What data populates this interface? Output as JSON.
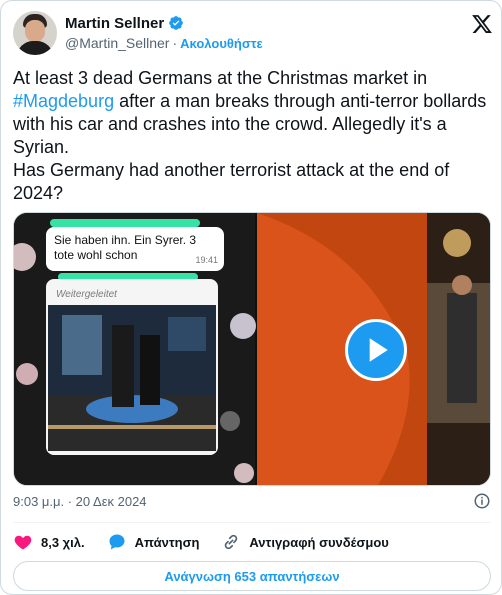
{
  "author": {
    "display_name": "Martin Sellner",
    "handle": "@Martin_Sellner",
    "separator": "·",
    "follow_label": "Ακολουθήστε"
  },
  "tweet": {
    "text_before_hashtag": "At least 3 dead Germans at the Christmas market in\n",
    "hashtag": "#Magdeburg",
    "text_after_hashtag": " after a man breaks through anti-terror bollards with his car and crashes into the crowd. Allegedly it's a Syrian.\nHas Germany had another terrorist attack at the end of 2024?"
  },
  "media": {
    "message_text": "Sie haben ihn. Ein Syrer. 3 tote wohl schon",
    "message_time": "19:41",
    "forwarded_label": "Weitergeleitet"
  },
  "meta": {
    "timestamp": "9:03 μ.μ. · 20 Δεκ 2024"
  },
  "actions": {
    "likes": "8,3 χιλ.",
    "reply_label": "Απάντηση",
    "copy_link_label": "Αντιγραφή συνδέσμου"
  },
  "read_replies_label": "Ανάγνωση 653 απαντήσεων",
  "colors": {
    "accent": "#1d9bf0",
    "like": "#f91880",
    "text_secondary": "#536471"
  }
}
